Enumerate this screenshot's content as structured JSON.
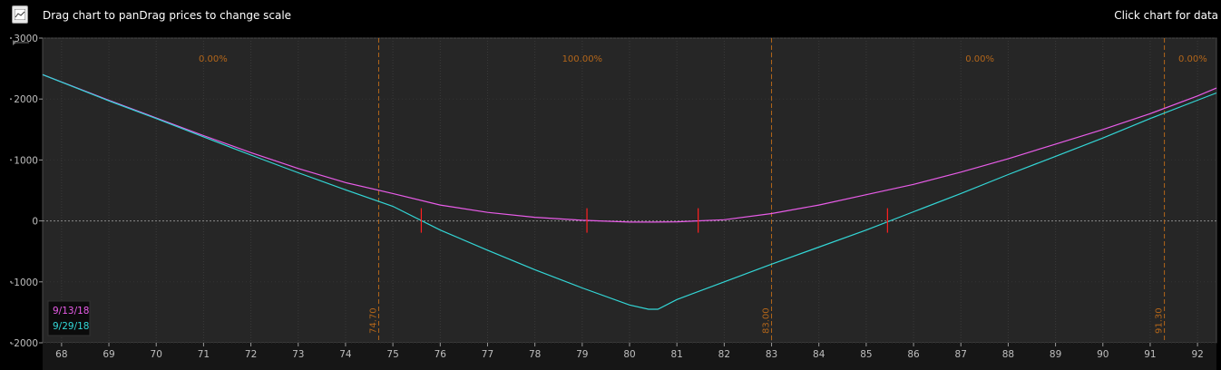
{
  "toolbar": {
    "icon": "chart-icon",
    "hint_left": "Drag chart to panDrag prices to change scale",
    "hint_right": "Click chart for data"
  },
  "colors": {
    "background": "#000000",
    "plot_bg": "#262626",
    "series_1": "#e85ce8",
    "series_2": "#33d6d6",
    "marker": "#ff2020",
    "vline": "#b3661a",
    "zero_line": "#8c8c8c"
  },
  "chart_data": {
    "type": "line",
    "xlim": [
      67.6,
      92.4
    ],
    "ylim": [
      -2000,
      3000
    ],
    "x_ticks": [
      68,
      69,
      70,
      71,
      72,
      73,
      74,
      75,
      76,
      77,
      78,
      79,
      80,
      81,
      82,
      83,
      84,
      85,
      86,
      87,
      88,
      89,
      90,
      91,
      92
    ],
    "y_ticks": [
      {
        "value": 3000,
        "label": "3000"
      },
      {
        "value": 2000,
        "label": "2000"
      },
      {
        "value": 1000,
        "label": "1000"
      },
      {
        "value": 0,
        "label": "0"
      },
      {
        "value": -1000,
        "label": "-1000"
      },
      {
        "value": -2000,
        "label": "-2000"
      }
    ],
    "grid": true,
    "zero_line": true,
    "vertical_lines": [
      {
        "x": 74.7,
        "label": "74.70"
      },
      {
        "x": 83.0,
        "label": "83.00"
      },
      {
        "x": 91.3,
        "label": "91.30"
      }
    ],
    "probabilities": [
      {
        "x": 71.2,
        "label": "0.00%"
      },
      {
        "x": 79.0,
        "label": "100.00%"
      },
      {
        "x": 87.4,
        "label": "0.00%"
      },
      {
        "x": 91.9,
        "label": "0.00%"
      }
    ],
    "series": [
      {
        "name": "9/13/18",
        "color": "#e85ce8",
        "x": [
          67.6,
          69,
          70,
          71,
          72,
          73,
          74,
          75,
          76,
          77,
          78,
          79,
          80,
          80.5,
          81,
          82,
          83,
          84,
          85,
          86,
          87,
          88,
          89,
          90,
          91,
          92,
          92.4
        ],
        "y": [
          2400,
          1980,
          1690,
          1400,
          1120,
          860,
          630,
          450,
          260,
          140,
          60,
          10,
          -20,
          -20,
          -15,
          20,
          120,
          260,
          430,
          600,
          800,
          1020,
          1260,
          1500,
          1760,
          2050,
          2180
        ]
      },
      {
        "name": "9/29/18",
        "color": "#33d6d6",
        "x": [
          67.6,
          69,
          70,
          71,
          72,
          73,
          74,
          75,
          76,
          77,
          78,
          79,
          80,
          80.4,
          80.6,
          81,
          82,
          83,
          84,
          85,
          86,
          87,
          88,
          89,
          90,
          91,
          92,
          92.4
        ],
        "y": [
          2400,
          1970,
          1680,
          1380,
          1080,
          790,
          510,
          240,
          -150,
          -480,
          -800,
          -1100,
          -1380,
          -1450,
          -1450,
          -1290,
          -1000,
          -710,
          -430,
          -150,
          150,
          450,
          760,
          1060,
          1360,
          1680,
          1980,
          2100
        ]
      }
    ],
    "markers": [
      {
        "x": 75.6,
        "y": 0
      },
      {
        "x": 79.1,
        "y": 0
      },
      {
        "x": 81.45,
        "y": 0
      },
      {
        "x": 85.45,
        "y": 0
      }
    ]
  }
}
